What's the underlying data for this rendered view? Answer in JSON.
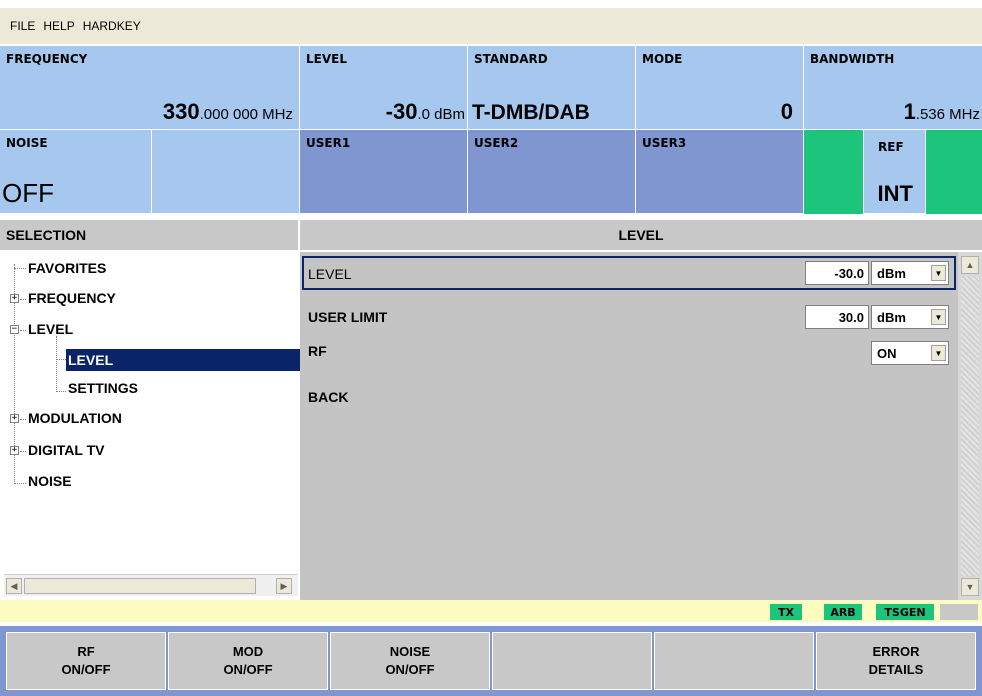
{
  "menu": {
    "items": [
      "FILE",
      "HELP",
      "HARDKEY"
    ]
  },
  "info": {
    "frequency": {
      "label": "FREQUENCY",
      "value_main": "330",
      "value_small": ".000 000 MHz"
    },
    "level": {
      "label": "LEVEL",
      "value_main": "-30",
      "value_small": ".0 dBm"
    },
    "standard": {
      "label": "STANDARD",
      "value": "T-DMB/DAB"
    },
    "mode": {
      "label": "MODE",
      "value": "0"
    },
    "bandwidth": {
      "label": "BANDWIDTH",
      "value_main": "1",
      "value_small": ".536 MHz"
    },
    "noise": {
      "label": "NOISE",
      "value": "OFF"
    },
    "user1": {
      "label": "USER1"
    },
    "user2": {
      "label": "USER2"
    },
    "user3": {
      "label": "USER3"
    },
    "ref": {
      "label": "REF",
      "value": "INT"
    }
  },
  "selection": {
    "header": "SELECTION"
  },
  "tree": {
    "favorites": "FAVORITES",
    "frequency": "FREQUENCY",
    "level": "LEVEL",
    "level_level": "LEVEL",
    "level_settings": "SETTINGS",
    "modulation": "MODULATION",
    "digital_tv": "DIGITAL TV",
    "noise": "NOISE"
  },
  "content": {
    "header": "LEVEL",
    "rows": {
      "level": {
        "label": "LEVEL",
        "value": "-30.0",
        "unit": "dBm"
      },
      "user_limit": {
        "label": "USER LIMIT",
        "value": "30.0",
        "unit": "dBm"
      },
      "rf": {
        "label": "RF",
        "value": "ON"
      },
      "back": {
        "label": "BACK"
      }
    }
  },
  "status": {
    "tags": [
      "TX",
      "ARB",
      "TSGEN"
    ]
  },
  "softkeys": {
    "rf": {
      "line1": "RF",
      "line2": "ON/OFF"
    },
    "mod": {
      "line1": "MOD",
      "line2": "ON/OFF"
    },
    "noise": {
      "line1": "NOISE",
      "line2": "ON/OFF"
    },
    "error": {
      "line1": "ERROR",
      "line2": "DETAILS"
    }
  },
  "colors": {
    "panel_blue": "#a6c8ee",
    "user_blue": "#8096d0",
    "green": "#1cc47c",
    "selected": "#0a246a",
    "status_yellow": "#fcfcc0"
  }
}
